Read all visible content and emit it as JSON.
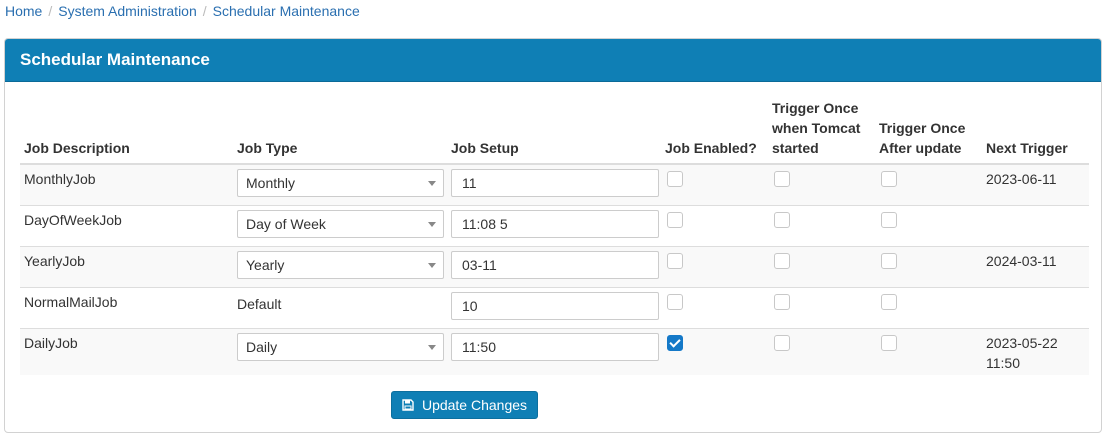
{
  "breadcrumb": {
    "items": [
      "Home",
      "System Administration",
      "Schedular Maintenance"
    ],
    "separator": "/"
  },
  "panel": {
    "title": "Schedular Maintenance",
    "header_color": "#0f7fb5"
  },
  "table": {
    "headers": {
      "job_description": "Job Description",
      "job_type": "Job Type",
      "job_setup": "Job Setup",
      "job_enabled": "Job Enabled?",
      "trigger_tomcat": "Trigger Once when Tomcat started",
      "trigger_update": "Trigger Once After update",
      "next_trigger": "Next Trigger"
    },
    "rows": [
      {
        "description": "MonthlyJob",
        "type": "Monthly",
        "setup": "11",
        "enabled": false,
        "trigger_tomcat": false,
        "trigger_update": false,
        "next_trigger": "2023-06-11"
      },
      {
        "description": "DayOfWeekJob",
        "type": "Day of Week",
        "setup": "11:08 5",
        "enabled": false,
        "trigger_tomcat": false,
        "trigger_update": false,
        "next_trigger": ""
      },
      {
        "description": "YearlyJob",
        "type": "Yearly",
        "setup": "03-11",
        "enabled": false,
        "trigger_tomcat": false,
        "trigger_update": false,
        "next_trigger": "2024-03-11"
      },
      {
        "description": "NormalMailJob",
        "type": "Default",
        "setup": "10",
        "enabled": false,
        "trigger_tomcat": false,
        "trigger_update": false,
        "next_trigger": ""
      },
      {
        "description": "DailyJob",
        "type": "Daily",
        "setup": "11:50",
        "enabled": true,
        "trigger_tomcat": false,
        "trigger_update": false,
        "next_trigger": "2023-05-22 11:50"
      }
    ]
  },
  "update_button": {
    "label": "Update Changes",
    "icon": "save-icon"
  }
}
